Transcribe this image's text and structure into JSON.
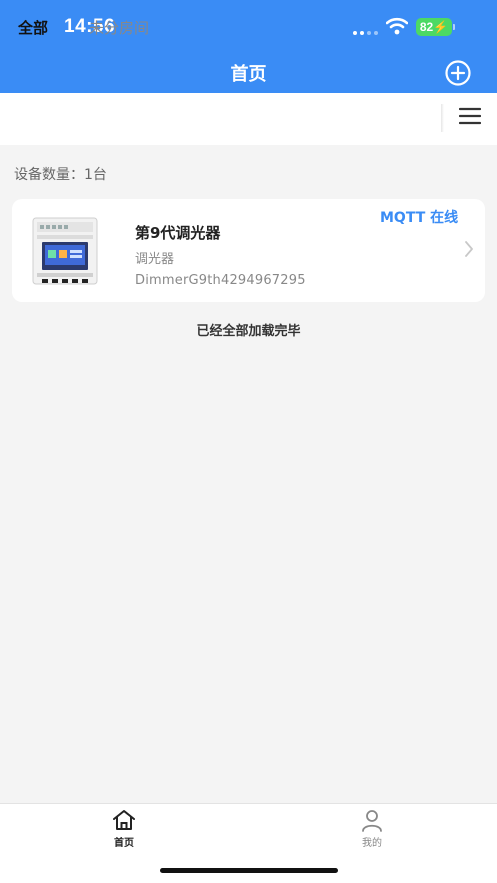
{
  "status_bar": {
    "time": "14:56",
    "battery": "82"
  },
  "header": {
    "title": "首页",
    "add_icon": "plus-circle-icon"
  },
  "tabs": [
    {
      "label": "全部",
      "active": true
    },
    {
      "label": "未分房间",
      "active": false
    }
  ],
  "device_count": "设备数量：1台",
  "devices": [
    {
      "name": "第9代调光器",
      "type": "调光器",
      "id": "DimmerG9th4294967295",
      "status": "MQTT 在线"
    }
  ],
  "list_end_text": "已经全部加载完毕",
  "bottom_nav": [
    {
      "label": "首页",
      "icon": "home-icon",
      "active": true
    },
    {
      "label": "我的",
      "icon": "user-icon",
      "active": false
    }
  ],
  "colors": {
    "primary": "#3a8cf5",
    "background": "#f4f4f4",
    "battery": "#4cd964"
  }
}
